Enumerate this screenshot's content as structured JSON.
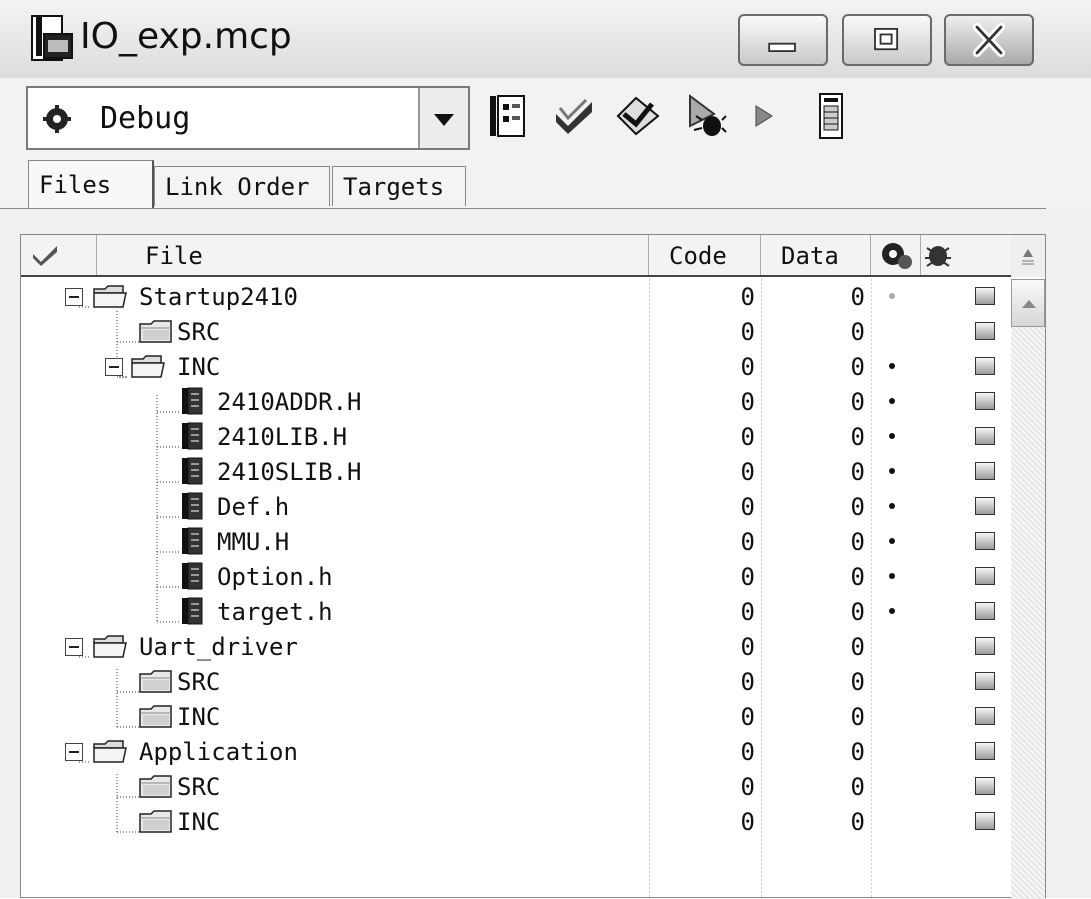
{
  "window": {
    "title": "IO_exp.mcp"
  },
  "toolbar": {
    "target": "Debug",
    "icons": [
      "target-settings-icon",
      "check-syntax-icon",
      "make-icon",
      "debug-icon",
      "run-icon",
      "project-inspector-icon"
    ]
  },
  "tabs": [
    {
      "label": "Files",
      "active": true
    },
    {
      "label": "Link Order",
      "active": false
    },
    {
      "label": "Targets",
      "active": false
    }
  ],
  "columns": {
    "check": "check-column-icon",
    "file": "File",
    "code": "Code",
    "data": "Data",
    "debug": "debug-column-icon",
    "touch": "touch-column-icon"
  },
  "rows": [
    {
      "name": "Startup2410",
      "kind": "group",
      "level": 0,
      "code": "0",
      "data": "0",
      "dot": "grey"
    },
    {
      "name": "SRC",
      "kind": "folder",
      "level": 1,
      "code": "0",
      "data": "0",
      "dot": ""
    },
    {
      "name": "INC",
      "kind": "group",
      "level": 1,
      "code": "0",
      "data": "0",
      "dot": "black"
    },
    {
      "name": "2410ADDR.H",
      "kind": "file",
      "level": 2,
      "code": "0",
      "data": "0",
      "dot": "black"
    },
    {
      "name": "2410LIB.H",
      "kind": "file",
      "level": 2,
      "code": "0",
      "data": "0",
      "dot": "black"
    },
    {
      "name": "2410SLIB.H",
      "kind": "file",
      "level": 2,
      "code": "0",
      "data": "0",
      "dot": "black"
    },
    {
      "name": "Def.h",
      "kind": "file",
      "level": 2,
      "code": "0",
      "data": "0",
      "dot": "black"
    },
    {
      "name": "MMU.H",
      "kind": "file",
      "level": 2,
      "code": "0",
      "data": "0",
      "dot": "black"
    },
    {
      "name": "Option.h",
      "kind": "file",
      "level": 2,
      "code": "0",
      "data": "0",
      "dot": "black"
    },
    {
      "name": "target.h",
      "kind": "file",
      "level": 2,
      "code": "0",
      "data": "0",
      "dot": "black"
    },
    {
      "name": "Uart_driver",
      "kind": "group",
      "level": 0,
      "code": "0",
      "data": "0",
      "dot": ""
    },
    {
      "name": "SRC",
      "kind": "folder",
      "level": 1,
      "code": "0",
      "data": "0",
      "dot": ""
    },
    {
      "name": "INC",
      "kind": "folder",
      "level": 1,
      "code": "0",
      "data": "0",
      "dot": ""
    },
    {
      "name": "Application",
      "kind": "group",
      "level": 0,
      "code": "0",
      "data": "0",
      "dot": ""
    },
    {
      "name": "SRC",
      "kind": "folder",
      "level": 1,
      "code": "0",
      "data": "0",
      "dot": ""
    },
    {
      "name": "INC",
      "kind": "folder",
      "level": 1,
      "code": "0",
      "data": "0",
      "dot": ""
    }
  ],
  "colors": {
    "titlebar": "#dcdcdc",
    "window": "#f0f0f0",
    "list": "#ffffff"
  }
}
